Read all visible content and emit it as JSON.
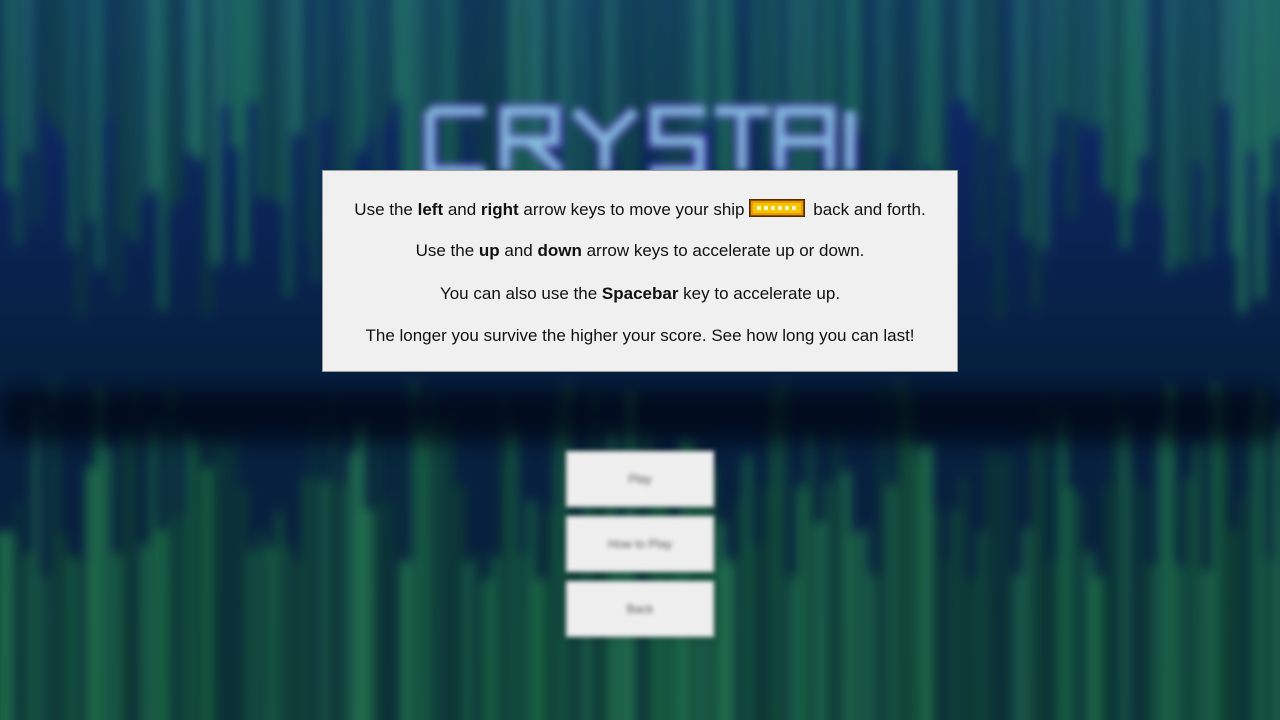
{
  "menu": {
    "play_label": "Play",
    "how_to_play_label": "How to Play",
    "back_label": "Back"
  },
  "dialog": {
    "line1": {
      "pre": "Use the ",
      "kw1": "left",
      "mid": " and ",
      "kw2": "right",
      "post": " arrow keys to move your ship",
      "end": " back and forth."
    },
    "line2": {
      "pre": "Use the ",
      "kw1": "up",
      "mid": " and ",
      "kw2": "down",
      "post": " arrow keys to accelerate up or down."
    },
    "line3": {
      "pre": "You can also use the ",
      "kw1": "Spacebar",
      "post": " key to accelerate up."
    },
    "line4": "The longer you survive the higher your score.  See how long you can last!"
  },
  "icons": {
    "ship": "ship-icon"
  },
  "colors": {
    "background": "#061a3a",
    "crystal_green": "#2aa84a",
    "logo_glow": "#8a4dff",
    "dialog_bg": "#f0f0f0",
    "ship_body": "#e89a00"
  }
}
